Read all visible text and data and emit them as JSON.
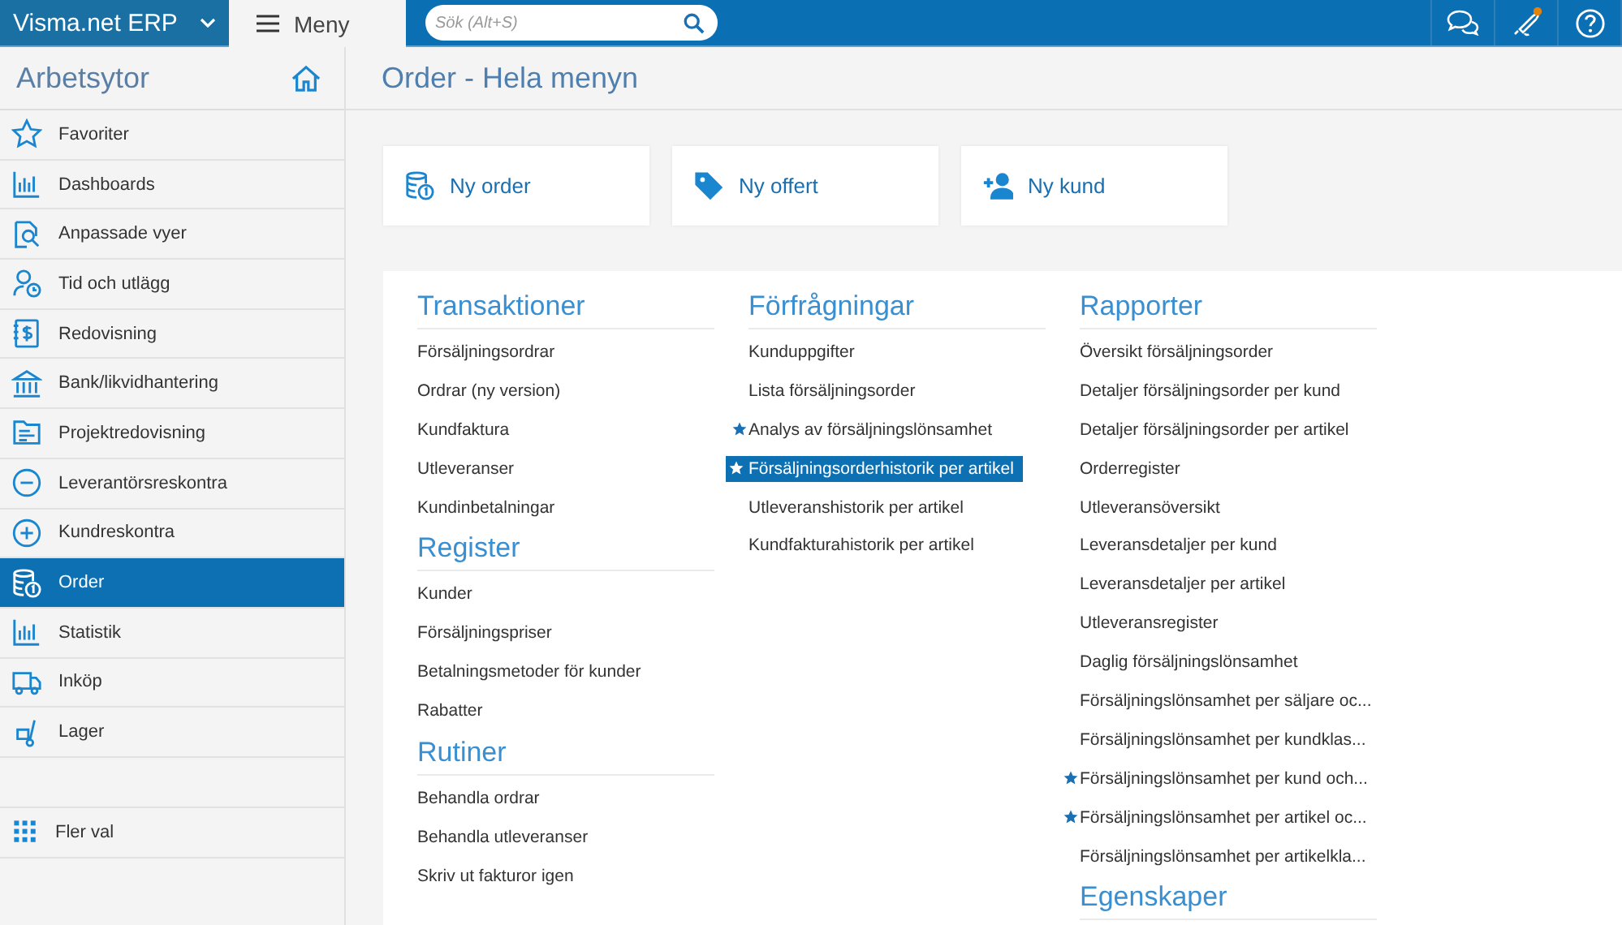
{
  "topbar": {
    "brand": "Visma.net ERP",
    "menu_label": "Meny",
    "search": {
      "placeholder": "Sök (Alt+S)"
    }
  },
  "sidebar": {
    "title": "Arbetsytor",
    "items": [
      {
        "label": "Favoriter",
        "selected": false
      },
      {
        "label": "Dashboards",
        "selected": false
      },
      {
        "label": "Anpassade vyer",
        "selected": false
      },
      {
        "label": "Tid och utlägg",
        "selected": false
      },
      {
        "label": "Redovisning",
        "selected": false
      },
      {
        "label": "Bank/likvidhantering",
        "selected": false
      },
      {
        "label": "Projektredovisning",
        "selected": false
      },
      {
        "label": "Leverantörsreskontra",
        "selected": false
      },
      {
        "label": "Kundreskontra",
        "selected": false
      },
      {
        "label": "Order",
        "selected": true
      },
      {
        "label": "Statistik",
        "selected": false
      },
      {
        "label": "Inköp",
        "selected": false
      },
      {
        "label": "Lager",
        "selected": false
      }
    ],
    "more": {
      "label": "Fler val"
    }
  },
  "page_title": "Order - Hela menyn",
  "quick_actions": [
    {
      "label": "Ny order"
    },
    {
      "label": "Ny offert"
    },
    {
      "label": "Ny kund"
    }
  ],
  "columns": [
    [
      {
        "heading": "Transaktioner",
        "items": [
          {
            "label": "Försäljningsordrar",
            "starred": false,
            "selected": false
          },
          {
            "label": "Ordrar (ny version)",
            "starred": false,
            "selected": false
          },
          {
            "label": "Kundfaktura",
            "starred": false,
            "selected": false
          },
          {
            "label": "Utleveranser",
            "starred": false,
            "selected": false
          },
          {
            "label": "Kundinbetalningar",
            "starred": false,
            "selected": false
          }
        ]
      },
      {
        "heading": "Register",
        "items": [
          {
            "label": "Kunder",
            "starred": false,
            "selected": false
          },
          {
            "label": "Försäljningspriser",
            "starred": false,
            "selected": false
          },
          {
            "label": "Betalningsmetoder för kunder",
            "starred": false,
            "selected": false
          },
          {
            "label": "Rabatter",
            "starred": false,
            "selected": false
          }
        ]
      },
      {
        "heading": "Rutiner",
        "items": [
          {
            "label": "Behandla ordrar",
            "starred": false,
            "selected": false
          },
          {
            "label": "Behandla utleveranser",
            "starred": false,
            "selected": false
          },
          {
            "label": "Skriv ut fakturor igen",
            "starred": false,
            "selected": false
          }
        ]
      }
    ],
    [
      {
        "heading": "Förfrågningar",
        "items": [
          {
            "label": "Kunduppgifter",
            "starred": false,
            "selected": false
          },
          {
            "label": "Lista försäljningsorder",
            "starred": false,
            "selected": false
          },
          {
            "label": "Analys av försäljningslönsamhet",
            "starred": true,
            "selected": false
          },
          {
            "label": "Försäljningsorderhistorik per artikel",
            "starred": true,
            "selected": true
          },
          {
            "label": "Utleveranshistorik per artikel",
            "starred": false,
            "selected": false
          },
          {
            "label": "Kundfakturahistorik per artikel",
            "starred": false,
            "selected": false
          }
        ]
      }
    ],
    [
      {
        "heading": "Rapporter",
        "items": [
          {
            "label": "Översikt försäljningsorder",
            "starred": false,
            "selected": false
          },
          {
            "label": "Detaljer försäljningsorder per kund",
            "starred": false,
            "selected": false
          },
          {
            "label": "Detaljer försäljningsorder per artikel",
            "starred": false,
            "selected": false
          },
          {
            "label": "Orderregister",
            "starred": false,
            "selected": false
          },
          {
            "label": "Utleveransöversikt",
            "starred": false,
            "selected": false
          },
          {
            "label": "Leveransdetaljer per kund",
            "starred": false,
            "selected": false
          },
          {
            "label": "Leveransdetaljer per artikel",
            "starred": false,
            "selected": false
          },
          {
            "label": "Utleveransregister",
            "starred": false,
            "selected": false
          },
          {
            "label": "Daglig försäljningslönsamhet",
            "starred": false,
            "selected": false
          },
          {
            "label": "Försäljningslönsamhet per säljare oc...",
            "starred": false,
            "selected": false
          },
          {
            "label": "Försäljningslönsamhet per kundklas...",
            "starred": false,
            "selected": false
          },
          {
            "label": "Försäljningslönsamhet per kund och...",
            "starred": true,
            "selected": false
          },
          {
            "label": "Försäljningslönsamhet per artikel oc...",
            "starred": true,
            "selected": false
          },
          {
            "label": "Försäljningslönsamhet per artikelkla...",
            "starred": false,
            "selected": false
          }
        ]
      },
      {
        "heading": "Egenskaper"
      }
    ]
  ]
}
